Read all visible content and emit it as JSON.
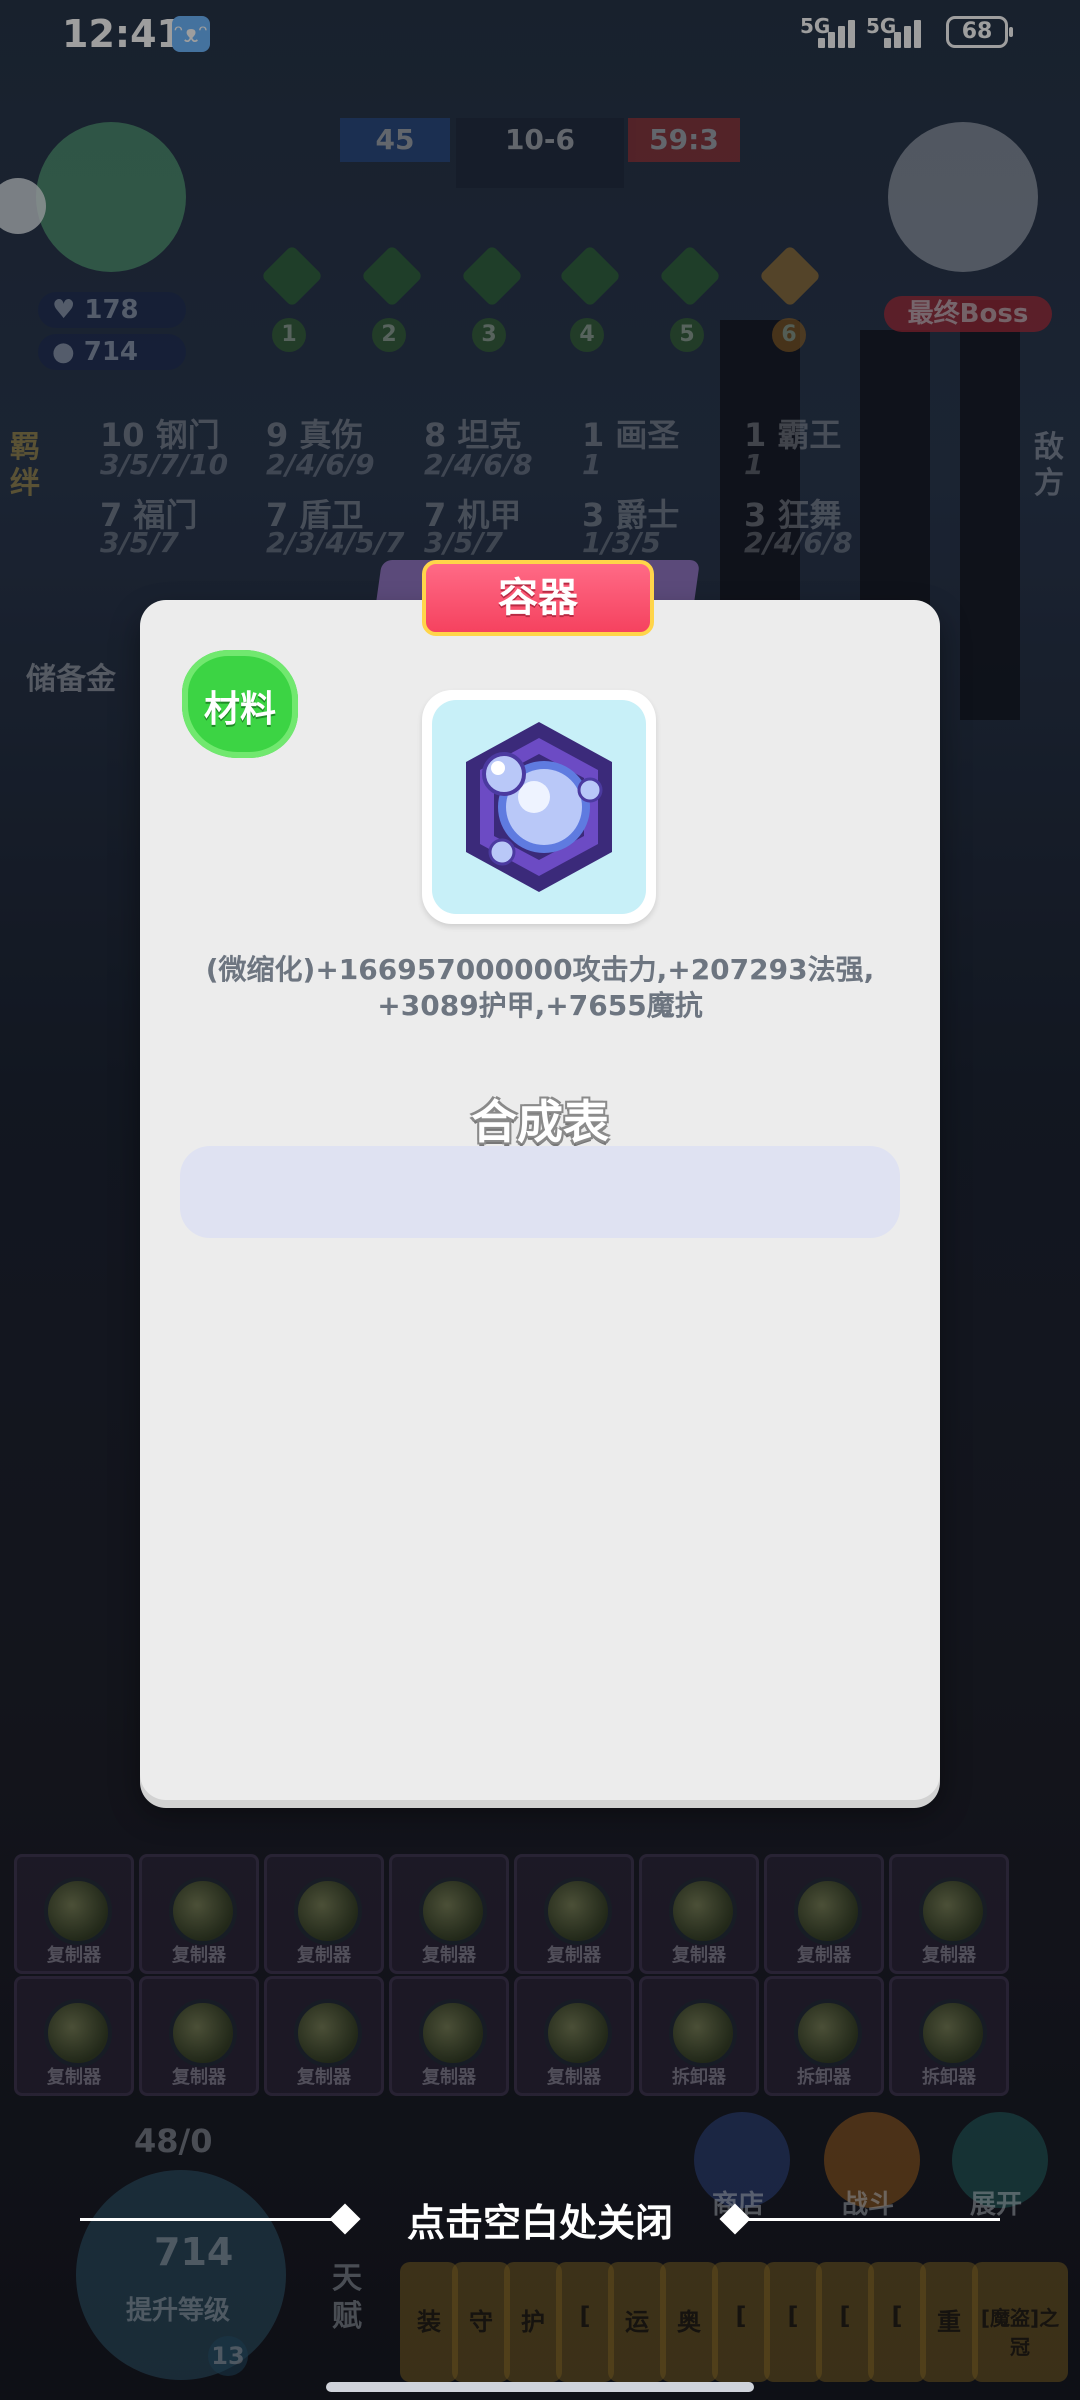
{
  "status_bar": {
    "time": "12:41",
    "signal_1": "5G",
    "signal_2": "5G",
    "battery": "68"
  },
  "hud": {
    "pause_icon": "pause-icon",
    "hp": "178",
    "gold": "714",
    "blue_score": "45",
    "stage": "10-6",
    "red_score": "59:3",
    "progress_nodes": [
      "1",
      "2",
      "3",
      "4",
      "5",
      "6"
    ],
    "boss_label": "最终Boss",
    "my_side_tab": "羁绊",
    "enemy_side_tab": "敌方",
    "piggy_label": "储备金"
  },
  "synergies": [
    {
      "count": "10",
      "name": "钢门",
      "tiers": "3/5/7/10"
    },
    {
      "count": "9",
      "name": "真伤",
      "tiers": "2/4/6/9"
    },
    {
      "count": "8",
      "name": "坦克",
      "tiers": "2/4/6/8"
    },
    {
      "count": "1",
      "name": "画圣",
      "tiers": "1"
    },
    {
      "count": "1",
      "name": "霸王",
      "tiers": "1"
    },
    {
      "count": "7",
      "name": "福门",
      "tiers": "3/5/7"
    },
    {
      "count": "7",
      "name": "盾卫",
      "tiers": "2/3/4/5/7"
    },
    {
      "count": "7",
      "name": "机甲",
      "tiers": "3/5/7"
    },
    {
      "count": "3",
      "name": "爵士",
      "tiers": "1/3/5"
    },
    {
      "count": "3",
      "name": "狂舞",
      "tiers": "2/4/6/8"
    }
  ],
  "modal": {
    "title": "容器",
    "badge": "材料",
    "item_icon": "orb-container-icon",
    "description_line1": "(微缩化)+166957000000攻击力,+207293法强,",
    "description_line2": "+3089护甲,+7655魔抗",
    "recipe_title": "合成表"
  },
  "close_hint": "点击空白处关闭",
  "bench": {
    "slots": [
      "复制器",
      "复制器",
      "复制器",
      "复制器",
      "复制器",
      "复制器",
      "复制器",
      "复制器",
      "复制器",
      "复制器",
      "复制器",
      "复制器",
      "复制器",
      "拆卸器",
      "拆卸器",
      "拆卸器"
    ]
  },
  "bottom": {
    "exp_text": "48/0",
    "gold_big": "714",
    "upgrade_label": "提升等级",
    "level": "13",
    "shop_label": "商店",
    "battle_label": "战斗",
    "expand_label": "展开",
    "talent_label": "天赋",
    "cards": [
      "装",
      "守",
      "护",
      "[",
      "运",
      "奥",
      "[",
      "[",
      "[",
      "[",
      "重",
      "[魔盗]之冠"
    ]
  }
}
